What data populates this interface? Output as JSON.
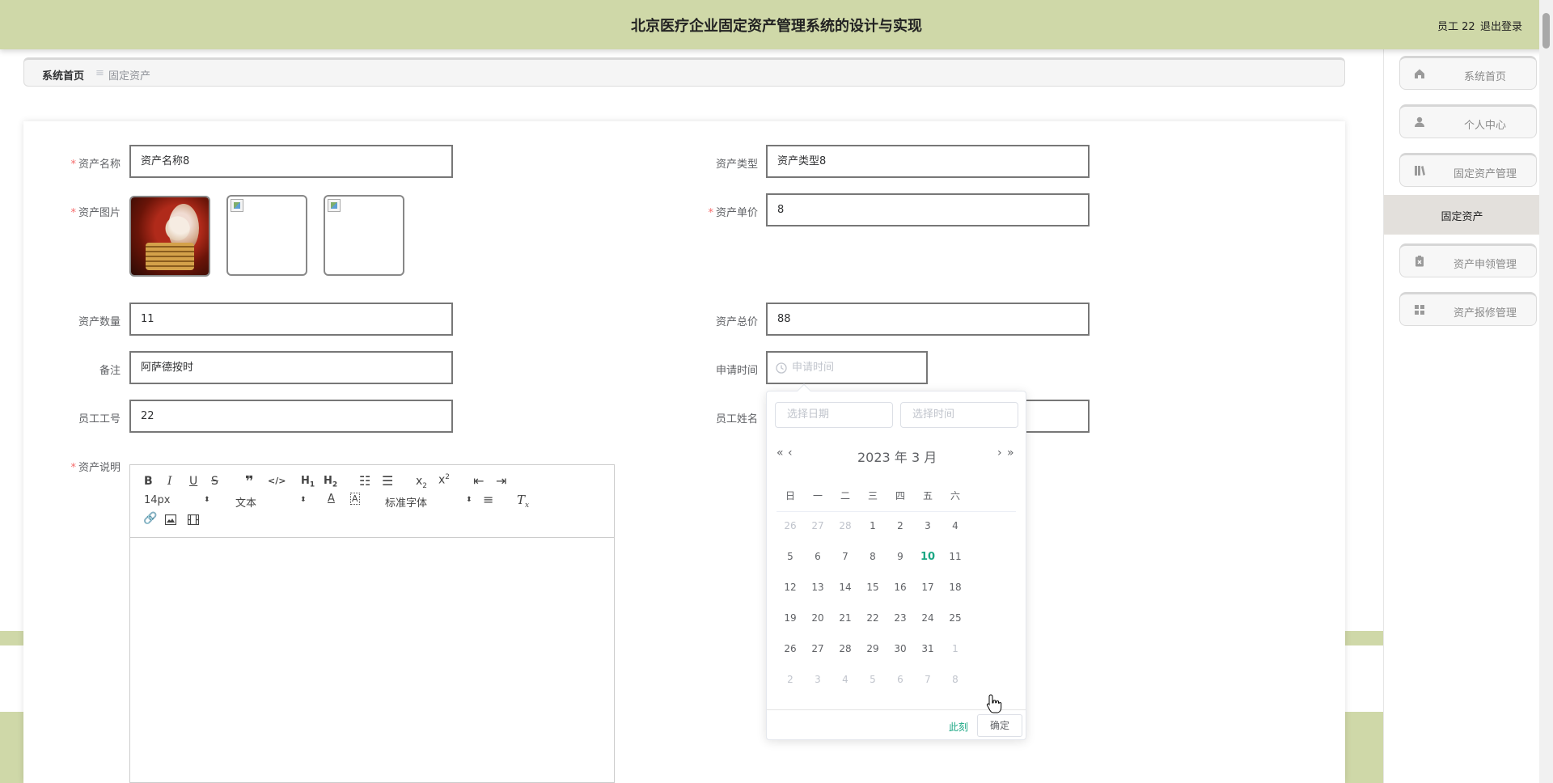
{
  "header": {
    "title": "北京医疗企业固定资产管理系统的设计与实现",
    "user": "员工 22",
    "logout": "退出登录"
  },
  "breadcrumb": {
    "home": "系统首页",
    "separator": "≡",
    "current": "固定资产"
  },
  "form": {
    "asset_name": {
      "label": "资产名称",
      "value": "资产名称8"
    },
    "asset_type": {
      "label": "资产类型",
      "value": "资产类型8"
    },
    "asset_image": {
      "label": "资产图片"
    },
    "unit_price": {
      "label": "资产单价",
      "value": "8"
    },
    "quantity": {
      "label": "资产数量",
      "value": "11"
    },
    "total_price": {
      "label": "资产总价",
      "value": "88"
    },
    "remark": {
      "label": "备注",
      "value": "阿萨德按时"
    },
    "apply_time": {
      "label": "申请时间",
      "placeholder": "申请时间"
    },
    "employee_id": {
      "label": "员工工号",
      "value": "22"
    },
    "employee_name": {
      "label": "员工姓名"
    },
    "description": {
      "label": "资产说明"
    }
  },
  "editor": {
    "font_size": "14px",
    "paragraph": "文本",
    "font_family": "标准字体"
  },
  "sidebar": {
    "items": [
      {
        "label": "系统首页",
        "icon": "home-icon"
      },
      {
        "label": "个人中心",
        "icon": "user-icon"
      },
      {
        "label": "固定资产管理",
        "icon": "book-icon"
      },
      {
        "label": "资产申领管理",
        "icon": "clipboard-icon"
      },
      {
        "label": "资产报修管理",
        "icon": "grid-icon"
      }
    ],
    "active_sub": "固定资产"
  },
  "datepicker": {
    "date_placeholder": "选择日期",
    "time_placeholder": "选择时间",
    "year_label": "2023 年",
    "month_label": "3 月",
    "weekdays": [
      "日",
      "一",
      "二",
      "三",
      "四",
      "五",
      "六"
    ],
    "weeks": [
      [
        {
          "d": "26",
          "o": 1
        },
        {
          "d": "27",
          "o": 1
        },
        {
          "d": "28",
          "o": 1
        },
        {
          "d": "1"
        },
        {
          "d": "2"
        },
        {
          "d": "3"
        },
        {
          "d": "4"
        }
      ],
      [
        {
          "d": "5"
        },
        {
          "d": "6"
        },
        {
          "d": "7"
        },
        {
          "d": "8"
        },
        {
          "d": "9"
        },
        {
          "d": "10",
          "t": 1
        },
        {
          "d": "11"
        }
      ],
      [
        {
          "d": "12"
        },
        {
          "d": "13"
        },
        {
          "d": "14"
        },
        {
          "d": "15"
        },
        {
          "d": "16"
        },
        {
          "d": "17"
        },
        {
          "d": "18"
        }
      ],
      [
        {
          "d": "19"
        },
        {
          "d": "20"
        },
        {
          "d": "21"
        },
        {
          "d": "22"
        },
        {
          "d": "23"
        },
        {
          "d": "24"
        },
        {
          "d": "25"
        }
      ],
      [
        {
          "d": "26"
        },
        {
          "d": "27"
        },
        {
          "d": "28"
        },
        {
          "d": "29"
        },
        {
          "d": "30"
        },
        {
          "d": "31"
        },
        {
          "d": "1",
          "o": 1
        }
      ],
      [
        {
          "d": "2",
          "o": 1
        },
        {
          "d": "3",
          "o": 1
        },
        {
          "d": "4",
          "o": 1
        },
        {
          "d": "5",
          "o": 1
        },
        {
          "d": "6",
          "o": 1
        },
        {
          "d": "7",
          "o": 1
        },
        {
          "d": "8",
          "o": 1
        }
      ]
    ],
    "now_label": "此刻",
    "confirm_label": "确定"
  },
  "colors": {
    "header_bg": "#cfd8a8",
    "accent": "#1ba784",
    "required": "#f56c6c"
  }
}
